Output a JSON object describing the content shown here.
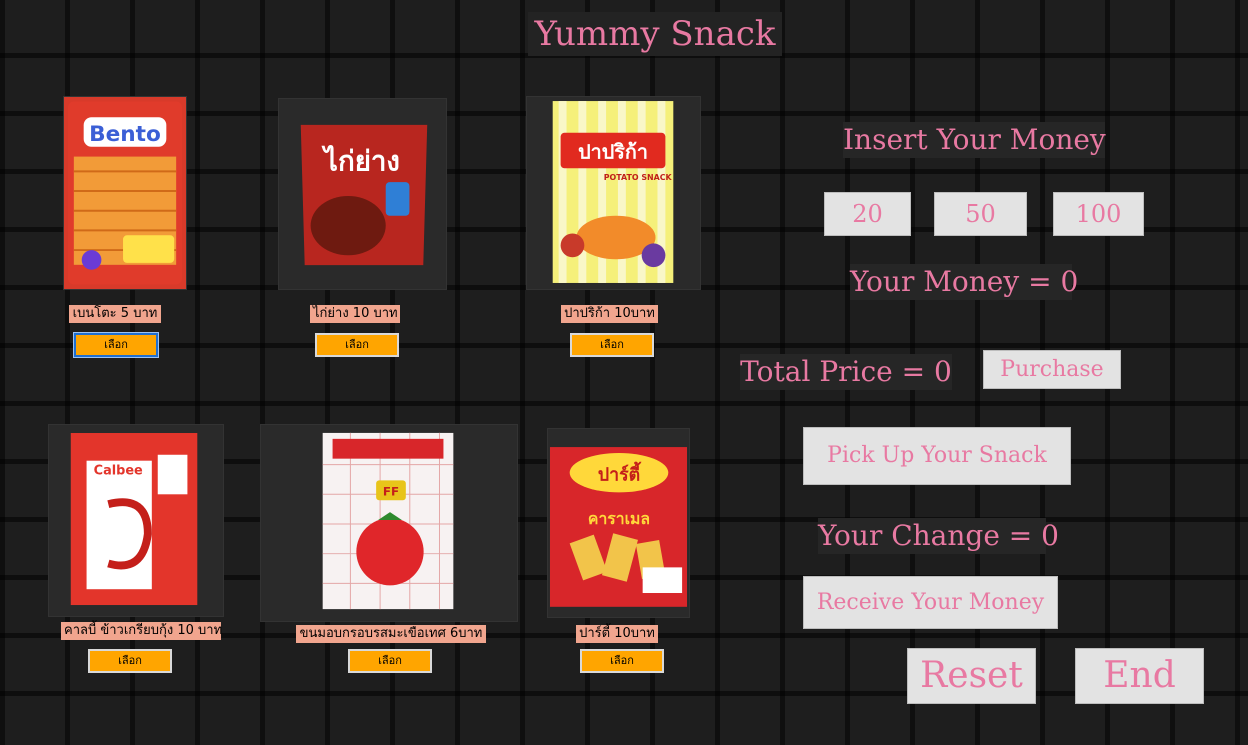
{
  "app": {
    "title": "Yummy Snack"
  },
  "products": [
    {
      "name": "เบนโตะ 5 บาท",
      "button": "เลือก",
      "brand": "Bento"
    },
    {
      "name": "ไก่ย่าง 10 บาท",
      "button": "เลือก",
      "brand": "ไก่ย่าง"
    },
    {
      "name": "ปาปริก้า 10บาท",
      "button": "เลือก",
      "brand": "ปาปริก้า",
      "subtitle": "POTATO SNACK"
    },
    {
      "name": "คาลบี้ ข้าวเกรียบกุ้ง 10 บาท",
      "button": "เลือก",
      "brand": "Calbee"
    },
    {
      "name": "ขนมอบกรอบรสมะเขือเทศ 6บาท",
      "button": "เลือก",
      "brand": "FF"
    },
    {
      "name": "ปาร์ตี้ 10บาท",
      "button": "เลือก",
      "brand": "ปาร์ตี้",
      "subtitle": "คาราเมล"
    }
  ],
  "panel": {
    "insert_label": "Insert Your Money",
    "money_buttons": [
      "20",
      "50",
      "100"
    ],
    "your_money": "Your Money = 0",
    "total_price": "Total Price = 0",
    "purchase": "Purchase",
    "pick_up": "Pick Up Your Snack",
    "your_change": "Your Change = 0",
    "receive": "Receive Your Money",
    "reset": "Reset",
    "end": "End"
  }
}
